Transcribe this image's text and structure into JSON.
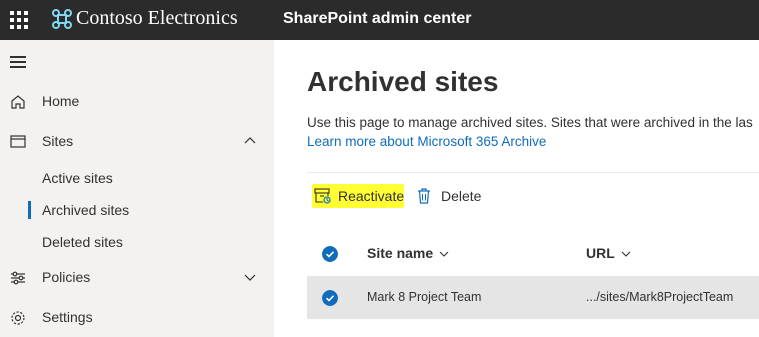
{
  "topbar": {
    "brand_name": "Contoso Electronics",
    "app_name": "SharePoint admin center"
  },
  "sidebar": {
    "items": [
      {
        "label": "Home",
        "icon": "home-icon"
      },
      {
        "label": "Sites",
        "icon": "sites-icon",
        "expanded": true
      },
      {
        "label": "Policies",
        "icon": "policies-icon",
        "expanded": false
      },
      {
        "label": "Settings",
        "icon": "gear-icon"
      }
    ],
    "sub_items": [
      {
        "label": "Active sites",
        "selected": false
      },
      {
        "label": "Archived sites",
        "selected": true
      },
      {
        "label": "Deleted sites",
        "selected": false
      }
    ]
  },
  "main": {
    "title": "Archived sites",
    "description": "Use this page to manage archived sites. Sites that were archived in the las",
    "learn_more": "Learn more about Microsoft 365 Archive",
    "commands": {
      "reactivate": "Reactivate",
      "delete": "Delete"
    },
    "table": {
      "columns": [
        "Site name",
        "URL"
      ],
      "rows": [
        {
          "site_name": "Mark 8 Project Team",
          "url": ".../sites/Mark8ProjectTeam",
          "selected": true
        }
      ]
    }
  },
  "colors": {
    "topbar_bg": "#2b2b2b",
    "sidebar_bg": "#f3f2f1",
    "accent": "#0f6cbd",
    "highlight": "#ffff33",
    "selected_row_bg": "#e5e5e5"
  }
}
